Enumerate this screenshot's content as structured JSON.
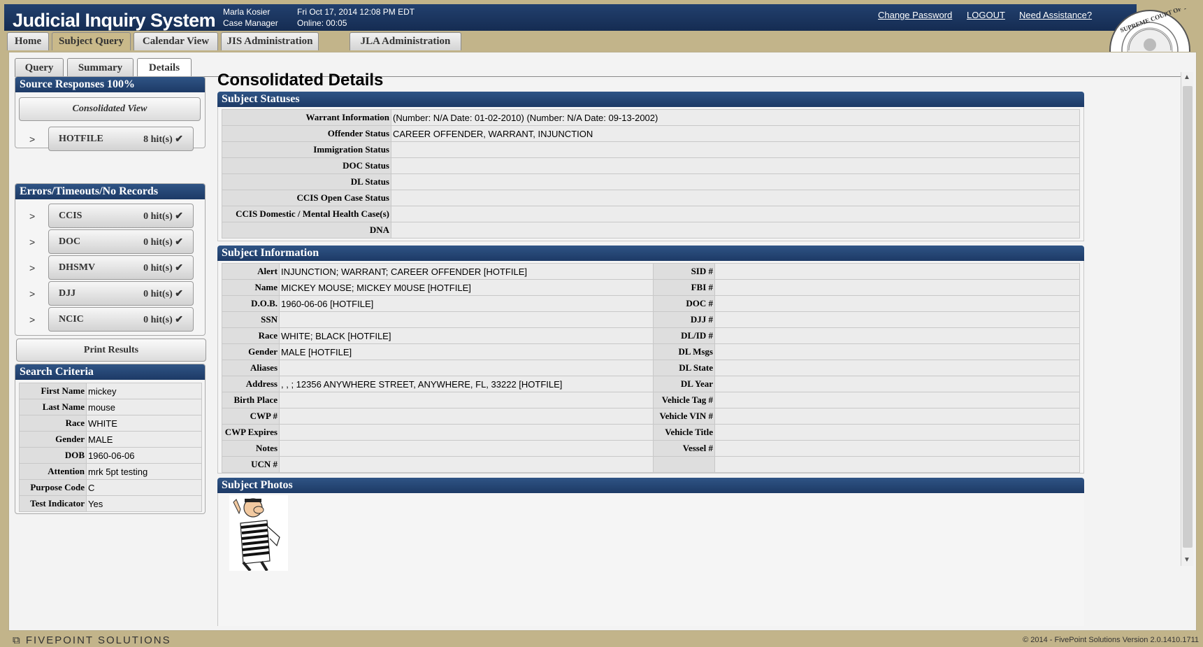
{
  "header": {
    "title": "Judicial Inquiry System",
    "user_name": "Marla Kosier",
    "user_role": "Case Manager",
    "datetime": "Fri Oct 17, 2014 12:08 PM EDT",
    "online": "Online: 00:05",
    "links": {
      "change_password": "Change Password",
      "logout": "LOGOUT",
      "assistance": "Need Assistance?"
    },
    "seal_text": "SUPREME COURT OF THE STATE OF FLORIDA"
  },
  "main_tabs": [
    "Home",
    "Subject Query",
    "Calendar View",
    "JIS Administration",
    "JLA Administration"
  ],
  "main_tab_active": "Subject Query",
  "sub_tabs": [
    "Query",
    "Summary",
    "Details"
  ],
  "sub_tab_active": "Details",
  "source_responses": {
    "title": "Source Responses 100%",
    "consolidated_label": "Consolidated View",
    "sources": [
      {
        "name": "HOTFILE",
        "hits": "8 hit(s)"
      }
    ]
  },
  "errors": {
    "title": "Errors/Timeouts/No Records",
    "sources": [
      {
        "name": "CCIS",
        "hits": "0 hit(s)"
      },
      {
        "name": "DOC",
        "hits": "0 hit(s)"
      },
      {
        "name": "DHSMV",
        "hits": "0 hit(s)"
      },
      {
        "name": "DJJ",
        "hits": "0 hit(s)"
      },
      {
        "name": "NCIC",
        "hits": "0 hit(s)"
      }
    ]
  },
  "print_label": "Print Results",
  "search_criteria": {
    "title": "Search Criteria",
    "rows": [
      {
        "label": "First Name",
        "value": "mickey"
      },
      {
        "label": "Last Name",
        "value": "mouse"
      },
      {
        "label": "Race",
        "value": "WHITE"
      },
      {
        "label": "Gender",
        "value": "MALE"
      },
      {
        "label": "DOB",
        "value": "1960-06-06"
      },
      {
        "label": "Attention",
        "value": "mrk 5pt testing"
      },
      {
        "label": "Purpose Code",
        "value": "C"
      },
      {
        "label": "Test Indicator",
        "value": "Yes"
      }
    ]
  },
  "details": {
    "title": "Consolidated Details",
    "statuses_title": "Subject Statuses",
    "statuses": [
      {
        "label": "Warrant Information",
        "value": "(Number: N/A Date: 01-02-2010)  (Number: N/A Date: 09-13-2002)"
      },
      {
        "label": "Offender Status",
        "value": "CAREER OFFENDER, WARRANT, INJUNCTION"
      },
      {
        "label": "Immigration Status",
        "value": ""
      },
      {
        "label": "DOC Status",
        "value": ""
      },
      {
        "label": "DL Status",
        "value": ""
      },
      {
        "label": "CCIS Open Case Status",
        "value": ""
      },
      {
        "label": "CCIS Domestic / Mental Health Case(s)",
        "value": ""
      },
      {
        "label": "DNA",
        "value": ""
      }
    ],
    "info_title": "Subject Information",
    "info_left": [
      {
        "label": "Alert",
        "value": "INJUNCTION; WARRANT; CAREER OFFENDER [HOTFILE]"
      },
      {
        "label": "Name",
        "value": "MICKEY MOUSE; MICKEY M0USE [HOTFILE]"
      },
      {
        "label": "D.O.B.",
        "value": "1960-06-06 [HOTFILE]"
      },
      {
        "label": "SSN",
        "value": ""
      },
      {
        "label": "Race",
        "value": "WHITE; BLACK [HOTFILE]"
      },
      {
        "label": "Gender",
        "value": "MALE [HOTFILE]"
      },
      {
        "label": "Aliases",
        "value": ""
      },
      {
        "label": "Address",
        "value": ", , ; 12356 ANYWHERE STREET, ANYWHERE, FL, 33222 [HOTFILE]"
      },
      {
        "label": "Birth Place",
        "value": ""
      },
      {
        "label": "CWP #",
        "value": ""
      },
      {
        "label": "CWP Expires",
        "value": ""
      },
      {
        "label": "Notes",
        "value": ""
      },
      {
        "label": "UCN #",
        "value": ""
      }
    ],
    "info_right": [
      {
        "label": "SID #",
        "value": ""
      },
      {
        "label": "FBI #",
        "value": ""
      },
      {
        "label": "DOC #",
        "value": ""
      },
      {
        "label": "DJJ #",
        "value": ""
      },
      {
        "label": "DL/ID #",
        "value": ""
      },
      {
        "label": "DL Msgs",
        "value": ""
      },
      {
        "label": "DL State",
        "value": ""
      },
      {
        "label": "DL Year",
        "value": ""
      },
      {
        "label": "Vehicle Tag #",
        "value": ""
      },
      {
        "label": "Vehicle VIN #",
        "value": ""
      },
      {
        "label": "Vehicle Title",
        "value": ""
      },
      {
        "label": "Vessel #",
        "value": ""
      },
      {
        "label": "",
        "value": ""
      }
    ],
    "photos_title": "Subject Photos"
  },
  "footer": {
    "logo": "FIVEPOINT SOLUTIONS",
    "copyright": "© 2014 - FivePoint Solutions   Version 2.0.1410.1711"
  }
}
